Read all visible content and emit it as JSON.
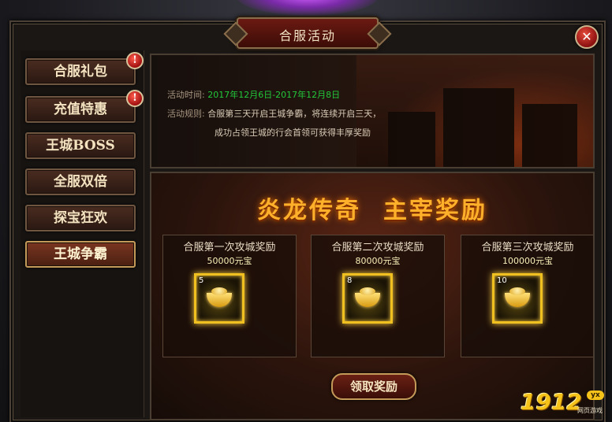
{
  "window": {
    "title": "合服活动",
    "close_icon": "close-icon"
  },
  "sidebar": {
    "items": [
      {
        "label": "合服礼包",
        "badge": "!"
      },
      {
        "label": "充值特惠",
        "badge": "!"
      },
      {
        "label": "王城BOSS"
      },
      {
        "label": "全服双倍"
      },
      {
        "label": "探宝狂欢"
      },
      {
        "label": "王城争霸",
        "active": true
      }
    ]
  },
  "info": {
    "time_label": "活动时间:",
    "time_value": "2017年12月6日-2017年12月8日",
    "rule_label": "活动规则:",
    "rule_line1": "合服第三天开启王城争霸，将连续开启三天，",
    "rule_line2": "成功占领王城的行会首领可获得丰厚奖励"
  },
  "rewards": {
    "title_left": "炎龙传奇",
    "title_right": "主宰奖励",
    "cards": [
      {
        "title": "合服第一次攻城奖励",
        "amount": "50000元宝",
        "count": "5"
      },
      {
        "title": "合服第二次攻城奖励",
        "amount": "80000元宝",
        "count": "8"
      },
      {
        "title": "合服第三次攻城奖励",
        "amount": "100000元宝",
        "count": "10"
      }
    ],
    "claim_label": "领取奖励"
  },
  "logo": {
    "number": "1912",
    "tag": "yx",
    "sub": "网页游戏"
  },
  "colors": {
    "accent_gold": "#ffb02a",
    "time_green": "#22c83a",
    "badge_red": "#a01010"
  }
}
